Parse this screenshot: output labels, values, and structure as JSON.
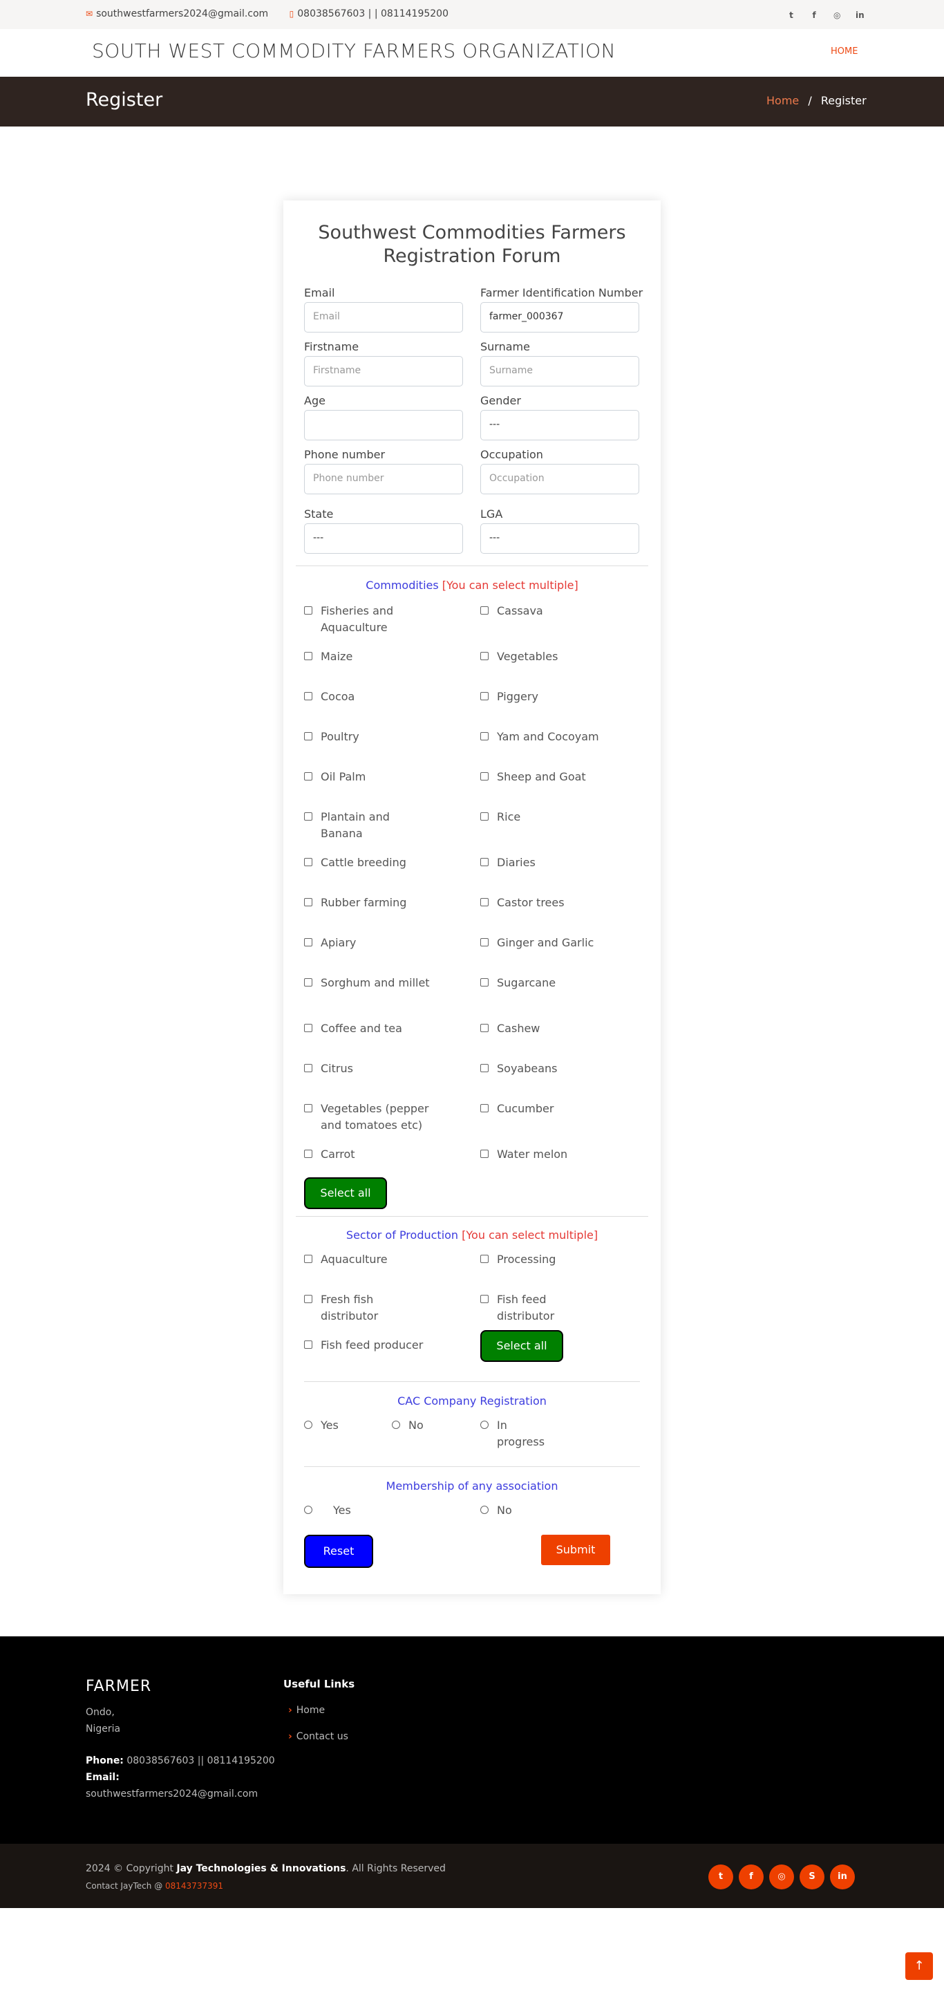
{
  "topbar": {
    "email": "southwestfarmers2024@gmail.com",
    "phones": "08038567603 | | 08114195200",
    "social_icons": [
      "twitter-icon",
      "facebook-icon",
      "instagram-icon",
      "linkedin-icon"
    ]
  },
  "header": {
    "logo": "SOUTH WEST COMMODITY FARMERS ORGANIZATION",
    "nav_home": "HOME"
  },
  "breadcrumbs": {
    "title": "Register",
    "home": "Home",
    "separator": "/",
    "current": "Register"
  },
  "form": {
    "title_line1": "Southwest Commodities Farmers",
    "title_line2": "Registration Forum",
    "fields": {
      "email": {
        "label": "Email",
        "placeholder": "Email"
      },
      "fin": {
        "label": "Farmer Identification Number",
        "value": "farmer_000367"
      },
      "firstname": {
        "label": "Firstname",
        "placeholder": "Firstname"
      },
      "surname": {
        "label": "Surname",
        "placeholder": "Surname"
      },
      "age": {
        "label": "Age",
        "value": ""
      },
      "gender": {
        "label": "Gender",
        "value": "---"
      },
      "phone": {
        "label": "Phone number",
        "placeholder": "Phone number"
      },
      "occupation": {
        "label": "Occupation",
        "placeholder": "Occupation"
      },
      "state": {
        "label": "State",
        "value": "---"
      },
      "lga": {
        "label": "LGA",
        "value": "---"
      }
    },
    "commodities": {
      "title": "Commodities",
      "hint": "[You can select multiple]",
      "items": [
        "Fisheries and Aquaculture",
        "Cassava",
        "Maize",
        "Vegetables",
        "Cocoa",
        "Piggery",
        "Poultry",
        "Yam and Cocoyam",
        "Oil Palm",
        "Sheep and Goat",
        "Plantain and Banana",
        "Rice",
        "Cattle breeding",
        "Diaries",
        "Rubber farming",
        "Castor trees",
        "Apiary",
        "Ginger and Garlic",
        "Sorghum and millet",
        "Sugarcane",
        "Coffee and tea",
        "Cashew",
        "Citrus",
        "Soyabeans",
        "Vegetables (pepper and tomatoes etc)",
        "Cucumber",
        "Carrot",
        "Water melon"
      ],
      "select_all": "Select all"
    },
    "sector": {
      "title": "Sector of Production",
      "hint": "[You can select multiple]",
      "items": [
        "Aquaculture",
        "Processing",
        "Fresh fish distributor",
        "Fish feed distributor",
        "Fish feed producer"
      ],
      "select_all": "Select all"
    },
    "cac": {
      "title": "CAC Company Registration",
      "options": [
        "Yes",
        "No",
        "In progress"
      ]
    },
    "membership": {
      "title": "Membership of any association",
      "options": [
        "Yes",
        "No"
      ]
    },
    "reset": "Reset",
    "submit": "Submit"
  },
  "footer": {
    "brand": "FARMER",
    "address_line1": "Ondo,",
    "address_line2": "Nigeria",
    "phone_label": "Phone:",
    "phone_value": "08038567603 || 08114195200",
    "email_label": "Email:",
    "email_value": "southwestfarmers2024@gmail.com",
    "links_title": "Useful Links",
    "links": [
      "Home",
      "Contact us"
    ]
  },
  "subfooter": {
    "copyright_prefix": "2024 © Copyright",
    "company": "Jay Technologies & Innovations",
    "rights": ". All Rights Reserved",
    "contact_prefix": "Contact JayTech @",
    "contact_phone": "08143737391",
    "social_icons": [
      "twitter-icon",
      "facebook-icon",
      "instagram-icon",
      "skype-icon",
      "linkedin-icon"
    ]
  },
  "colors": {
    "accent": "#ee4a14",
    "breadcrumb_bg": "#2f2420",
    "green_button": "#008000",
    "blue_button": "#0000ff"
  }
}
